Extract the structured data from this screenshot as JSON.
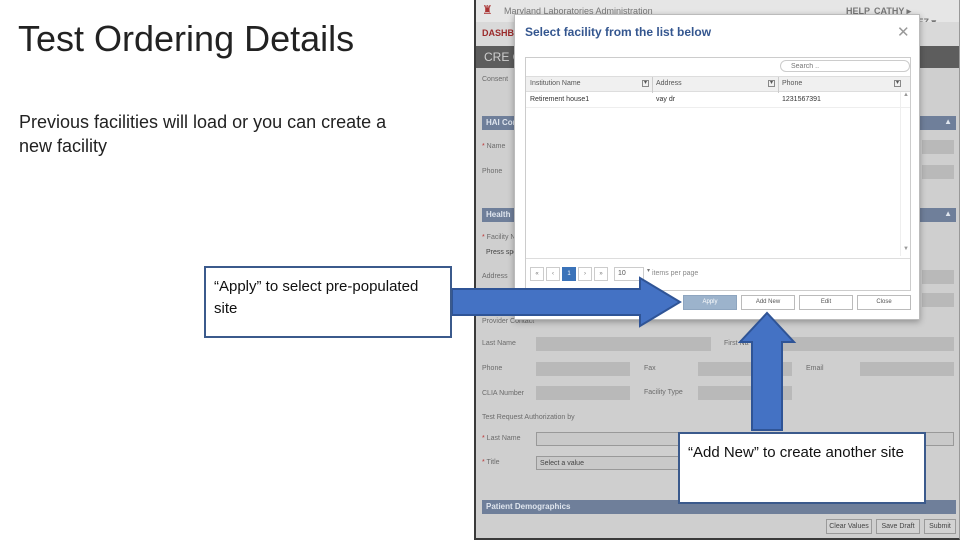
{
  "slide": {
    "title": "Test Ordering Details",
    "body": "Previous facilities will load or you can create a new facility",
    "callout_apply": "“Apply” to select pre-populated site",
    "callout_add_new": "“Add New” to create another site"
  },
  "app": {
    "name": "Maryland Laboratories Administration",
    "help": "HELP",
    "user": "CATHY ▸ DOMINGUEZ ▾",
    "nav_dashboard": "DASHBOA",
    "header": "CRE CO",
    "consent_label": "Consent",
    "sections": {
      "hai": "HAI Con",
      "health": "Health",
      "patient": "Patient Demographics"
    },
    "labels": {
      "name": "Name",
      "phone": "Phone",
      "facility": "Facility Na",
      "press": "Press spe",
      "address": "Address",
      "provider_contact": "Provider Contact",
      "last_name": "Last Name",
      "first_name": "First Na",
      "phone2": "Phone",
      "fax": "Fax",
      "email": "Email",
      "clia": "CLIA Number",
      "facility_type": "Facility Type",
      "authorization": "Test Request Authorization by",
      "last_name_req": "Last Name",
      "title": "Title",
      "select_value": "Select a value"
    },
    "bottom_buttons": [
      "Clear Values",
      "Save Draft",
      "Submit"
    ]
  },
  "modal": {
    "title": "Select facility from the list below",
    "close": "✕",
    "search_placeholder": "Search ..",
    "columns": [
      "Institution Name",
      "Address",
      "Phone"
    ],
    "rows": [
      {
        "name": "Retirement house1",
        "address": "vay dr",
        "phone": "1231567391"
      }
    ],
    "pager": {
      "first": "«",
      "prev": "‹",
      "current": "1",
      "next": "›",
      "last": "»",
      "page_size": "10",
      "page_size_label": "items per page"
    },
    "buttons": {
      "apply": "Apply",
      "add_new": "Add New",
      "edit": "Edit",
      "close": "Close"
    }
  },
  "colors": {
    "callout_border": "#3b5a8c",
    "arrow_fill": "#4472c4",
    "arrow_stroke": "#2f5496",
    "modal_title": "#34568f"
  },
  "icons": {
    "search": "search-icon",
    "close": "close-icon",
    "filter": "filter-icon"
  }
}
